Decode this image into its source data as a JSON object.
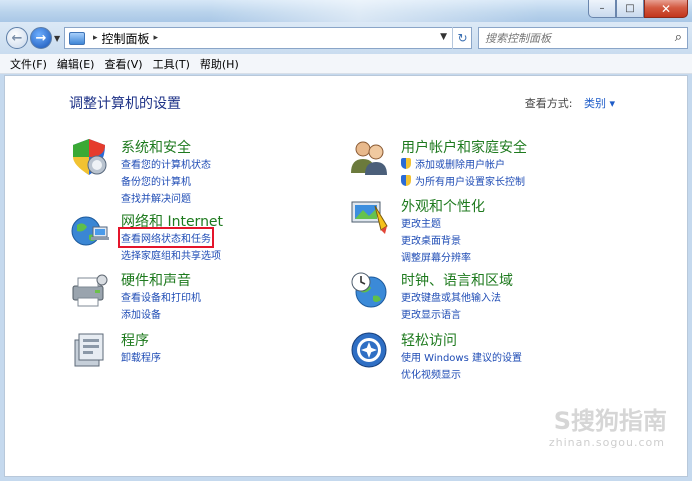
{
  "window": {
    "minimize": "–",
    "maximize": "□",
    "close": "✕"
  },
  "nav": {
    "address_arrow_1": "▸",
    "address_arrow_2": "▸",
    "address_location": "控制面板",
    "search_placeholder": "搜索控制面板"
  },
  "menu": [
    "文件(F)",
    "编辑(E)",
    "查看(V)",
    "工具(T)",
    "帮助(H)"
  ],
  "page": {
    "title": "调整计算机的设置",
    "view_label": "查看方式:",
    "view_value": "类别 ▾"
  },
  "categories": {
    "system": {
      "title": "系统和安全",
      "links": [
        "查看您的计算机状态",
        "备份您的计算机",
        "查找并解决问题"
      ]
    },
    "network": {
      "title": "网络和 Internet",
      "links": [
        "查看网络状态和任务",
        "选择家庭组和共享选项"
      ]
    },
    "hardware": {
      "title": "硬件和声音",
      "links": [
        "查看设备和打印机",
        "添加设备"
      ]
    },
    "programs": {
      "title": "程序",
      "links": [
        "卸载程序"
      ]
    },
    "users": {
      "title": "用户帐户和家庭安全",
      "links": [
        "添加或删除用户帐户",
        "为所有用户设置家长控制"
      ]
    },
    "appearance": {
      "title": "外观和个性化",
      "links": [
        "更改主题",
        "更改桌面背景",
        "调整屏幕分辨率"
      ]
    },
    "clock": {
      "title": "时钟、语言和区域",
      "links": [
        "更改键盘或其他输入法",
        "更改显示语言"
      ]
    },
    "ease": {
      "title": "轻松访问",
      "links": [
        "使用 Windows 建议的设置",
        "优化视频显示"
      ]
    }
  },
  "watermark": {
    "logo": "S搜狗指南",
    "url": "zhinan.sogou.com"
  }
}
